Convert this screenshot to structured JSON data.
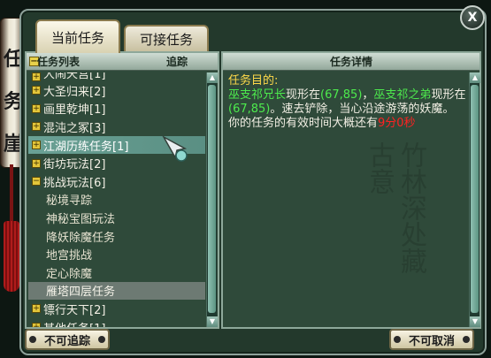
{
  "side_scroll": {
    "chars": [
      "任",
      "务",
      "崖"
    ]
  },
  "window": {
    "close_label": "X"
  },
  "tabs": [
    {
      "label": "当前任务",
      "active": true
    },
    {
      "label": "可接任务",
      "active": false
    }
  ],
  "list_panel": {
    "header_title": "任务列表",
    "header_track": "追踪",
    "rows": [
      {
        "label": "大闹天宫[1]",
        "type": "group",
        "state": "cut"
      },
      {
        "label": "大圣归来[2]",
        "type": "group"
      },
      {
        "label": "画里乾坤[1]",
        "type": "group"
      },
      {
        "label": "混沌之冢[3]",
        "type": "group"
      },
      {
        "label": "江湖历练任务[1]",
        "type": "group",
        "state": "highlight"
      },
      {
        "label": "街坊玩法[2]",
        "type": "group"
      },
      {
        "label": "挑战玩法[6]",
        "type": "group",
        "expanded": true
      },
      {
        "label": "秘境寻踪",
        "type": "sub"
      },
      {
        "label": "神秘宝图玩法",
        "type": "sub"
      },
      {
        "label": "降妖除魔任务",
        "type": "sub"
      },
      {
        "label": "地宫挑战",
        "type": "sub"
      },
      {
        "label": "定心除魔",
        "type": "sub"
      },
      {
        "label": "雁塔四层任务",
        "type": "sub",
        "state": "selected"
      },
      {
        "label": "镖行天下[2]",
        "type": "group"
      },
      {
        "label": "其他任务[1]",
        "type": "group"
      }
    ]
  },
  "detail_panel": {
    "header_title": "任务详情",
    "objective_label": "任务目的:",
    "npc1": "巫支祁兄长",
    "text1": "现形在",
    "coord1": "(67,85)",
    "sep": "，",
    "npc2": "巫支祁之弟",
    "text2": "现形在",
    "coord2": "(67,85)",
    "text3": "。速去铲除，当心沿途游荡的妖魔。",
    "time_text": "你的任务的有效时间大概还有",
    "time_value": "9分0秒",
    "watermark": "竹林深处藏古意"
  },
  "buttons": {
    "untrack": "不可追踪",
    "cancel": "不可取消"
  },
  "colors": {
    "panel_bg": "#2f4a3a",
    "highlight": "#6aa195",
    "objective": "#ffd94a",
    "npc": "#4dea4d",
    "time": "#ff2222"
  }
}
